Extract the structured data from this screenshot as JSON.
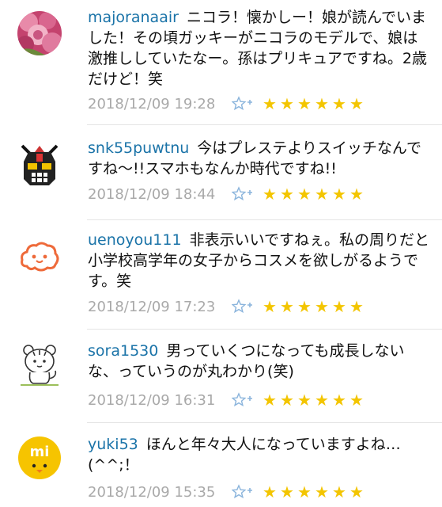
{
  "accent_color": "#1a73a8",
  "star_color": "#f3c500",
  "comments": [
    {
      "username": "majoranaair",
      "avatar": "pink-rose-photo",
      "text": "ニコラ！懐かしー！娘が読んでいました！その頃ガッキーがニコラのモデルで、娘は激推ししていたなー。孫はプリキュアですね。2歳だけど！笑",
      "timestamp": "2018/12/09 19:28",
      "rating_icon": "star-plus-icon",
      "stars": "★★★★★★"
    },
    {
      "username": "snk55puwtnu",
      "avatar": "robot-helmet",
      "text": "今はプレステよりスイッチなんですね〜!!スマホもなんか時代ですね!!",
      "timestamp": "2018/12/09 18:44",
      "rating_icon": "star-plus-icon",
      "stars": "★★★★★★"
    },
    {
      "username": "uenoyou111",
      "avatar": "orange-cloud-face",
      "text": "非表示いいですねぇ。私の周りだと小学校高学年の女子からコスメを欲しがるようです。笑",
      "timestamp": "2018/12/09 17:23",
      "rating_icon": "star-plus-icon",
      "stars": "★★★★★★"
    },
    {
      "username": "sora1530",
      "avatar": "white-tiger-cartoon",
      "text": "男っていくつになっても成長しないな、っていうのが丸わかり(笑)",
      "timestamp": "2018/12/09 16:31",
      "rating_icon": "star-plus-icon",
      "stars": "★★★★★★"
    },
    {
      "username": "yuki53",
      "avatar": "yellow-mi-chick",
      "text": "ほんと年々大人になっていますよね…(^^;！",
      "timestamp": "2018/12/09 15:35",
      "rating_icon": "star-plus-icon",
      "stars": "★★★★★★"
    }
  ]
}
